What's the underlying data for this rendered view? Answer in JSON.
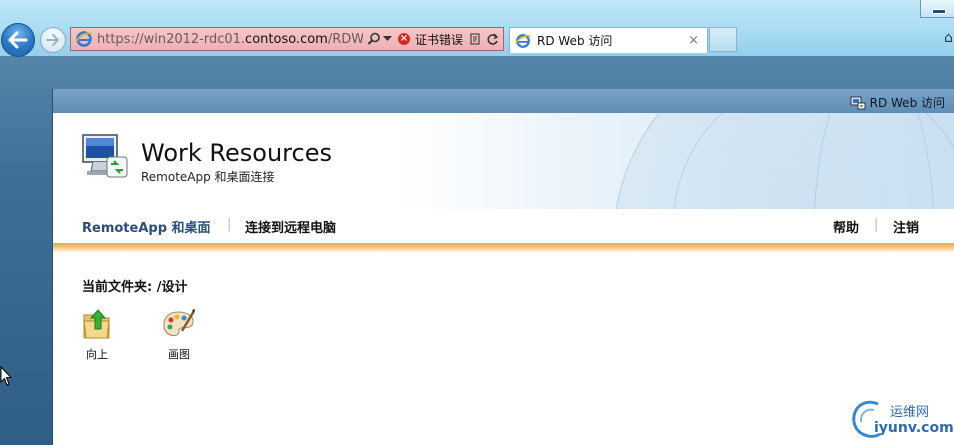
{
  "browser": {
    "address_url_prefix": "https://win2012-rdc01.",
    "address_url_domain": "contoso.com",
    "address_url_suffix": "/RDWeb/F",
    "cert_error_label": "证书错误",
    "tab_title": "RD Web 访问",
    "tab_close": "×"
  },
  "page": {
    "topbar_link": "RD Web 访问",
    "title": "Work Resources",
    "subtitle": "RemoteApp 和桌面连接",
    "nav": {
      "remoteapp": "RemoteApp 和桌面",
      "separator": "|",
      "connect_remote": "连接到远程电脑",
      "help": "帮助",
      "logout": "注销"
    },
    "current_folder": "当前文件夹: /设计",
    "items": [
      {
        "label": "向上",
        "icon": "folder-up-icon"
      },
      {
        "label": "画图",
        "icon": "paint-palette-icon"
      }
    ]
  },
  "watermark": {
    "line1": "运维网",
    "line2": "iyunv.com"
  },
  "colors": {
    "accent_nav": "#2a4f7a",
    "orange_bar": "#f0a640",
    "address_error_bg": "#f7c7c9"
  }
}
